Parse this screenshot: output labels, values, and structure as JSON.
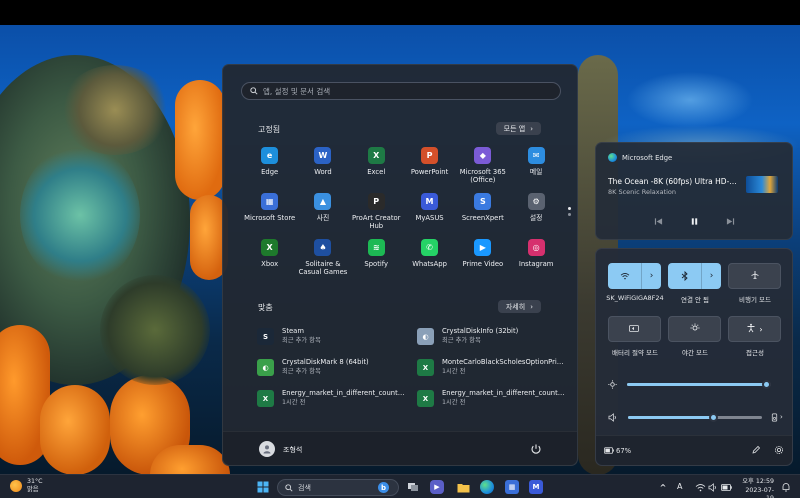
{
  "start_menu": {
    "search_placeholder": "앱, 설정 및 문서 검색",
    "pinned_title": "고정됨",
    "all_apps_label": "모든 앱",
    "pinned_apps": [
      {
        "label": "Edge",
        "icon": "edge-icon",
        "color": "#1d8fdc",
        "glyph": "e"
      },
      {
        "label": "Word",
        "icon": "word-icon",
        "color": "#2b62c5",
        "glyph": "W"
      },
      {
        "label": "Excel",
        "icon": "excel-icon",
        "color": "#1e7a45",
        "glyph": "X"
      },
      {
        "label": "PowerPoint",
        "icon": "powerpoint-icon",
        "color": "#d4502a",
        "glyph": "P"
      },
      {
        "label": "Microsoft 365 (Office)",
        "icon": "microsoft365-icon",
        "color": "#7b5bd6",
        "glyph": "◆"
      },
      {
        "label": "메일",
        "icon": "mail-icon",
        "color": "#2d8de0",
        "glyph": "✉"
      },
      {
        "label": "Microsoft Store",
        "icon": "store-icon",
        "color": "#3a6fd8",
        "glyph": "▦"
      },
      {
        "label": "사진",
        "icon": "photos-icon",
        "color": "#3a90e0",
        "glyph": "▲"
      },
      {
        "label": "ProArt Creator Hub",
        "icon": "proart-icon",
        "color": "#2a2a2a",
        "glyph": "P"
      },
      {
        "label": "MyASUS",
        "icon": "myasus-icon",
        "color": "#3a5ad8",
        "glyph": "M"
      },
      {
        "label": "ScreenXpert",
        "icon": "screenxpert-icon",
        "color": "#3a7ae0",
        "glyph": "S"
      },
      {
        "label": "설정",
        "icon": "settings-gear-icon",
        "color": "#5a6270",
        "glyph": "⚙"
      },
      {
        "label": "Xbox",
        "icon": "xbox-icon",
        "color": "#1e7a2c",
        "glyph": "X"
      },
      {
        "label": "Solitaire & Casual Games",
        "icon": "solitaire-icon",
        "color": "#1e4fa0",
        "glyph": "♠"
      },
      {
        "label": "Spotify",
        "icon": "spotify-icon",
        "color": "#1db954",
        "glyph": "≋"
      },
      {
        "label": "WhatsApp",
        "icon": "whatsapp-icon",
        "color": "#25d366",
        "glyph": "✆"
      },
      {
        "label": "Prime Video",
        "icon": "prime-video-icon",
        "color": "#1a98ff",
        "glyph": "▶"
      },
      {
        "label": "Instagram",
        "icon": "instagram-icon",
        "color": "#d6306e",
        "glyph": "◎"
      }
    ],
    "recommended_title": "맞춤",
    "more_label": "자세히",
    "recommended": [
      {
        "name": "Steam",
        "sub": "최근 추가 항목",
        "icon": "steam-icon",
        "color": "#1b2838",
        "glyph": "S"
      },
      {
        "name": "CrystalDiskInfo (32bit)",
        "sub": "최근 추가 항목",
        "icon": "crystaldiskinfo-icon",
        "color": "#8aa0b8",
        "glyph": "◐"
      },
      {
        "name": "CrystalDiskMark 8 (64bit)",
        "sub": "최근 추가 항목",
        "icon": "crystaldiskmark-icon",
        "color": "#3aa04a",
        "glyph": "◐"
      },
      {
        "name": "MonteCarloBlackScholesOptionPric...",
        "sub": "1시간 전",
        "icon": "excel-file-icon",
        "color": "#1e7a45",
        "glyph": "X"
      },
      {
        "name": "Energy_market_in_different_countri...",
        "sub": "1시간 전",
        "icon": "excel-file-icon",
        "color": "#1e7a45",
        "glyph": "X"
      },
      {
        "name": "Energy_market_in_different_countri...",
        "sub": "1시간 전",
        "icon": "excel-file-icon",
        "color": "#1e7a45",
        "glyph": "X"
      }
    ],
    "user_name": "조형석"
  },
  "media": {
    "app_name": "Microsoft Edge",
    "title": "The Ocean -8K (60fps) Ultra HD- 자...",
    "subtitle": "8K Scenic Relaxation"
  },
  "quick_settings": {
    "tiles": [
      {
        "label": "SK_WiFiGIGA8F24",
        "icon": "wifi-icon",
        "on": true,
        "split": true
      },
      {
        "label": "연결 안 됨",
        "icon": "bluetooth-icon",
        "on": true,
        "split": true
      },
      {
        "label": "비행기 모드",
        "icon": "airplane-icon",
        "on": false,
        "split": false
      },
      {
        "label": "배터리 절약 모드",
        "icon": "battery-saver-icon",
        "on": false,
        "split": false
      },
      {
        "label": "야간 모드",
        "icon": "night-light-icon",
        "on": false,
        "split": false
      },
      {
        "label": "접근성",
        "icon": "accessibility-icon",
        "on": false,
        "split": false
      }
    ],
    "brightness": 0.97,
    "volume": 0.64,
    "battery": "67%",
    "accent": "#8ccaf3"
  },
  "taskbar": {
    "weather_temp": "31°C",
    "weather_desc": "맑음",
    "search_placeholder": "검색",
    "language": "A",
    "time": "오후 12:59",
    "date": "2023-07-19"
  }
}
